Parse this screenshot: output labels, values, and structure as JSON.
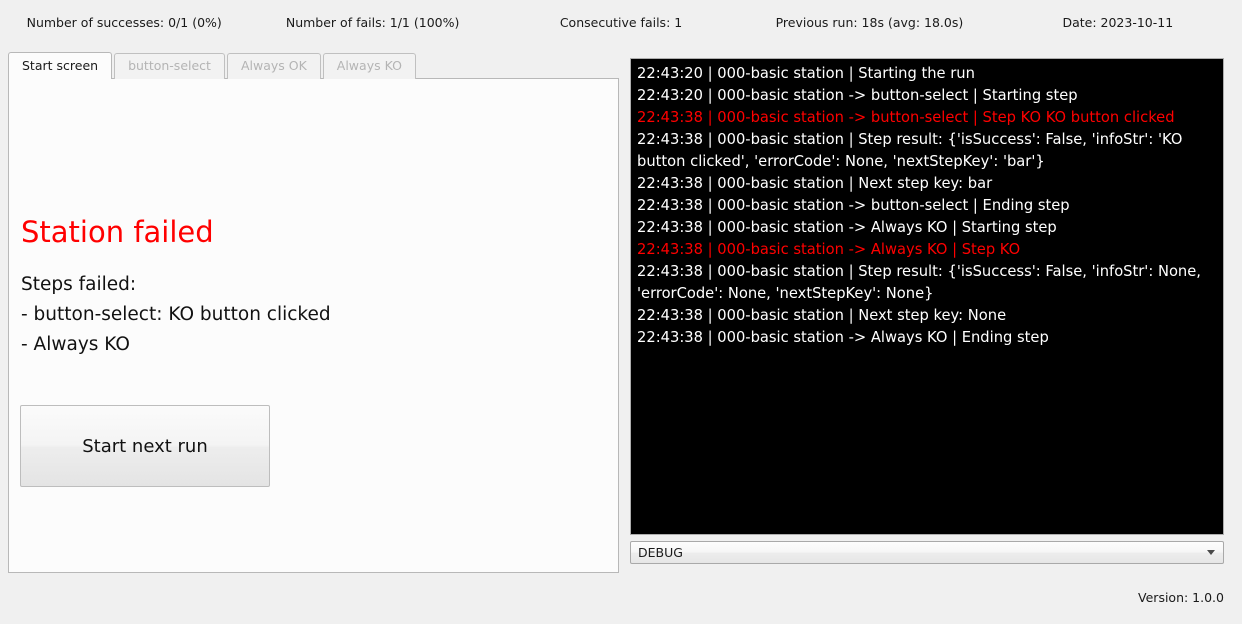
{
  "statusbar": {
    "successes": "Number of successes: 0/1 (0%)",
    "fails": "Number of fails: 1/1 (100%)",
    "consecutive_fails": "Consecutive fails: 1",
    "previous_run": "Previous run: 18s (avg: 18.0s)",
    "date": "Date: 2023-10-11"
  },
  "tabs": [
    {
      "label": "Start screen",
      "state": "active"
    },
    {
      "label": "button-select",
      "state": "disabled"
    },
    {
      "label": "Always OK",
      "state": "disabled"
    },
    {
      "label": "Always KO",
      "state": "disabled"
    }
  ],
  "main": {
    "title": "Station failed",
    "title_color": "#ff0000",
    "steps_failed_text": "Steps failed:\n- button-select: KO button clicked\n- Always KO",
    "start_button_label": "Start next run"
  },
  "log": {
    "lines": [
      {
        "text": "22:43:20 | 000-basic station | Starting the run",
        "level": "info"
      },
      {
        "text": "22:43:20 | 000-basic station -> button-select | Starting step",
        "level": "info"
      },
      {
        "text": "22:43:38 | 000-basic station -> button-select | Step KO KO button clicked",
        "level": "error"
      },
      {
        "text": "22:43:38 | 000-basic station | Step result: {'isSuccess': False, 'infoStr': 'KO button clicked', 'errorCode': None, 'nextStepKey': 'bar'}",
        "level": "info"
      },
      {
        "text": "22:43:38 | 000-basic station | Next step key: bar",
        "level": "info"
      },
      {
        "text": "22:43:38 | 000-basic station -> button-select | Ending step",
        "level": "info"
      },
      {
        "text": "22:43:38 | 000-basic station -> Always KO | Starting step",
        "level": "info"
      },
      {
        "text": "22:43:38 | 000-basic station -> Always KO | Step KO",
        "level": "error"
      },
      {
        "text": "22:43:38 | 000-basic station | Step result: {'isSuccess': False, 'infoStr': None, 'errorCode': None, 'nextStepKey': None}",
        "level": "info"
      },
      {
        "text": "22:43:38 | 000-basic station | Next step key: None",
        "level": "info"
      },
      {
        "text": "22:43:38 | 000-basic station -> Always KO | Ending step",
        "level": "info"
      }
    ],
    "info_color": "#ffffff",
    "error_color": "#ff0000",
    "background": "#000000"
  },
  "loglevel": {
    "selected": "DEBUG",
    "icon": "chevron-down-icon"
  },
  "footer": {
    "version": "Version: 1.0.0"
  }
}
